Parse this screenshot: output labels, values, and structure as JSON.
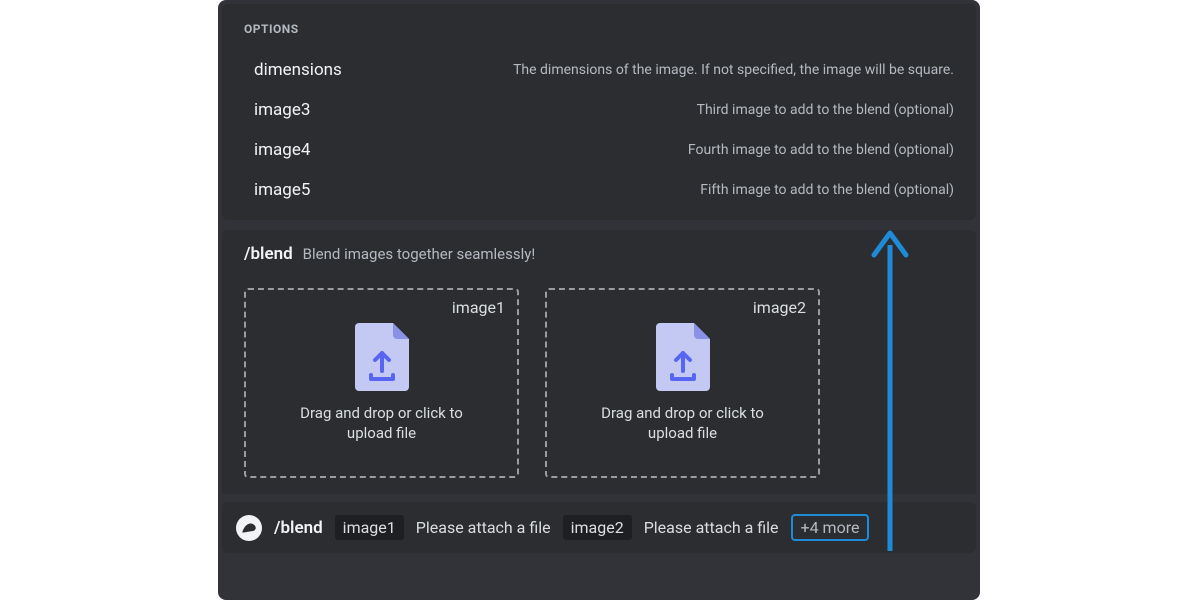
{
  "options": {
    "header": "OPTIONS",
    "items": [
      {
        "name": "dimensions",
        "desc": "The dimensions of the image. If not specified, the image will be square."
      },
      {
        "name": "image3",
        "desc": "Third image to add to the blend (optional)"
      },
      {
        "name": "image4",
        "desc": "Fourth image to add to the blend (optional)"
      },
      {
        "name": "image5",
        "desc": "Fifth image to add to the blend (optional)"
      }
    ]
  },
  "command": {
    "name": "/blend",
    "desc": "Blend images together seamlessly!"
  },
  "upload_slots": [
    {
      "label": "image1",
      "hint": "Drag and drop or click to upload file"
    },
    {
      "label": "image2",
      "hint": "Drag and drop or click to upload file"
    }
  ],
  "input_bar": {
    "command": "/blend",
    "params": [
      {
        "name": "image1",
        "value": "Please attach a file"
      },
      {
        "name": "image2",
        "value": "Please attach a file"
      }
    ],
    "more_label": "+4 more"
  }
}
